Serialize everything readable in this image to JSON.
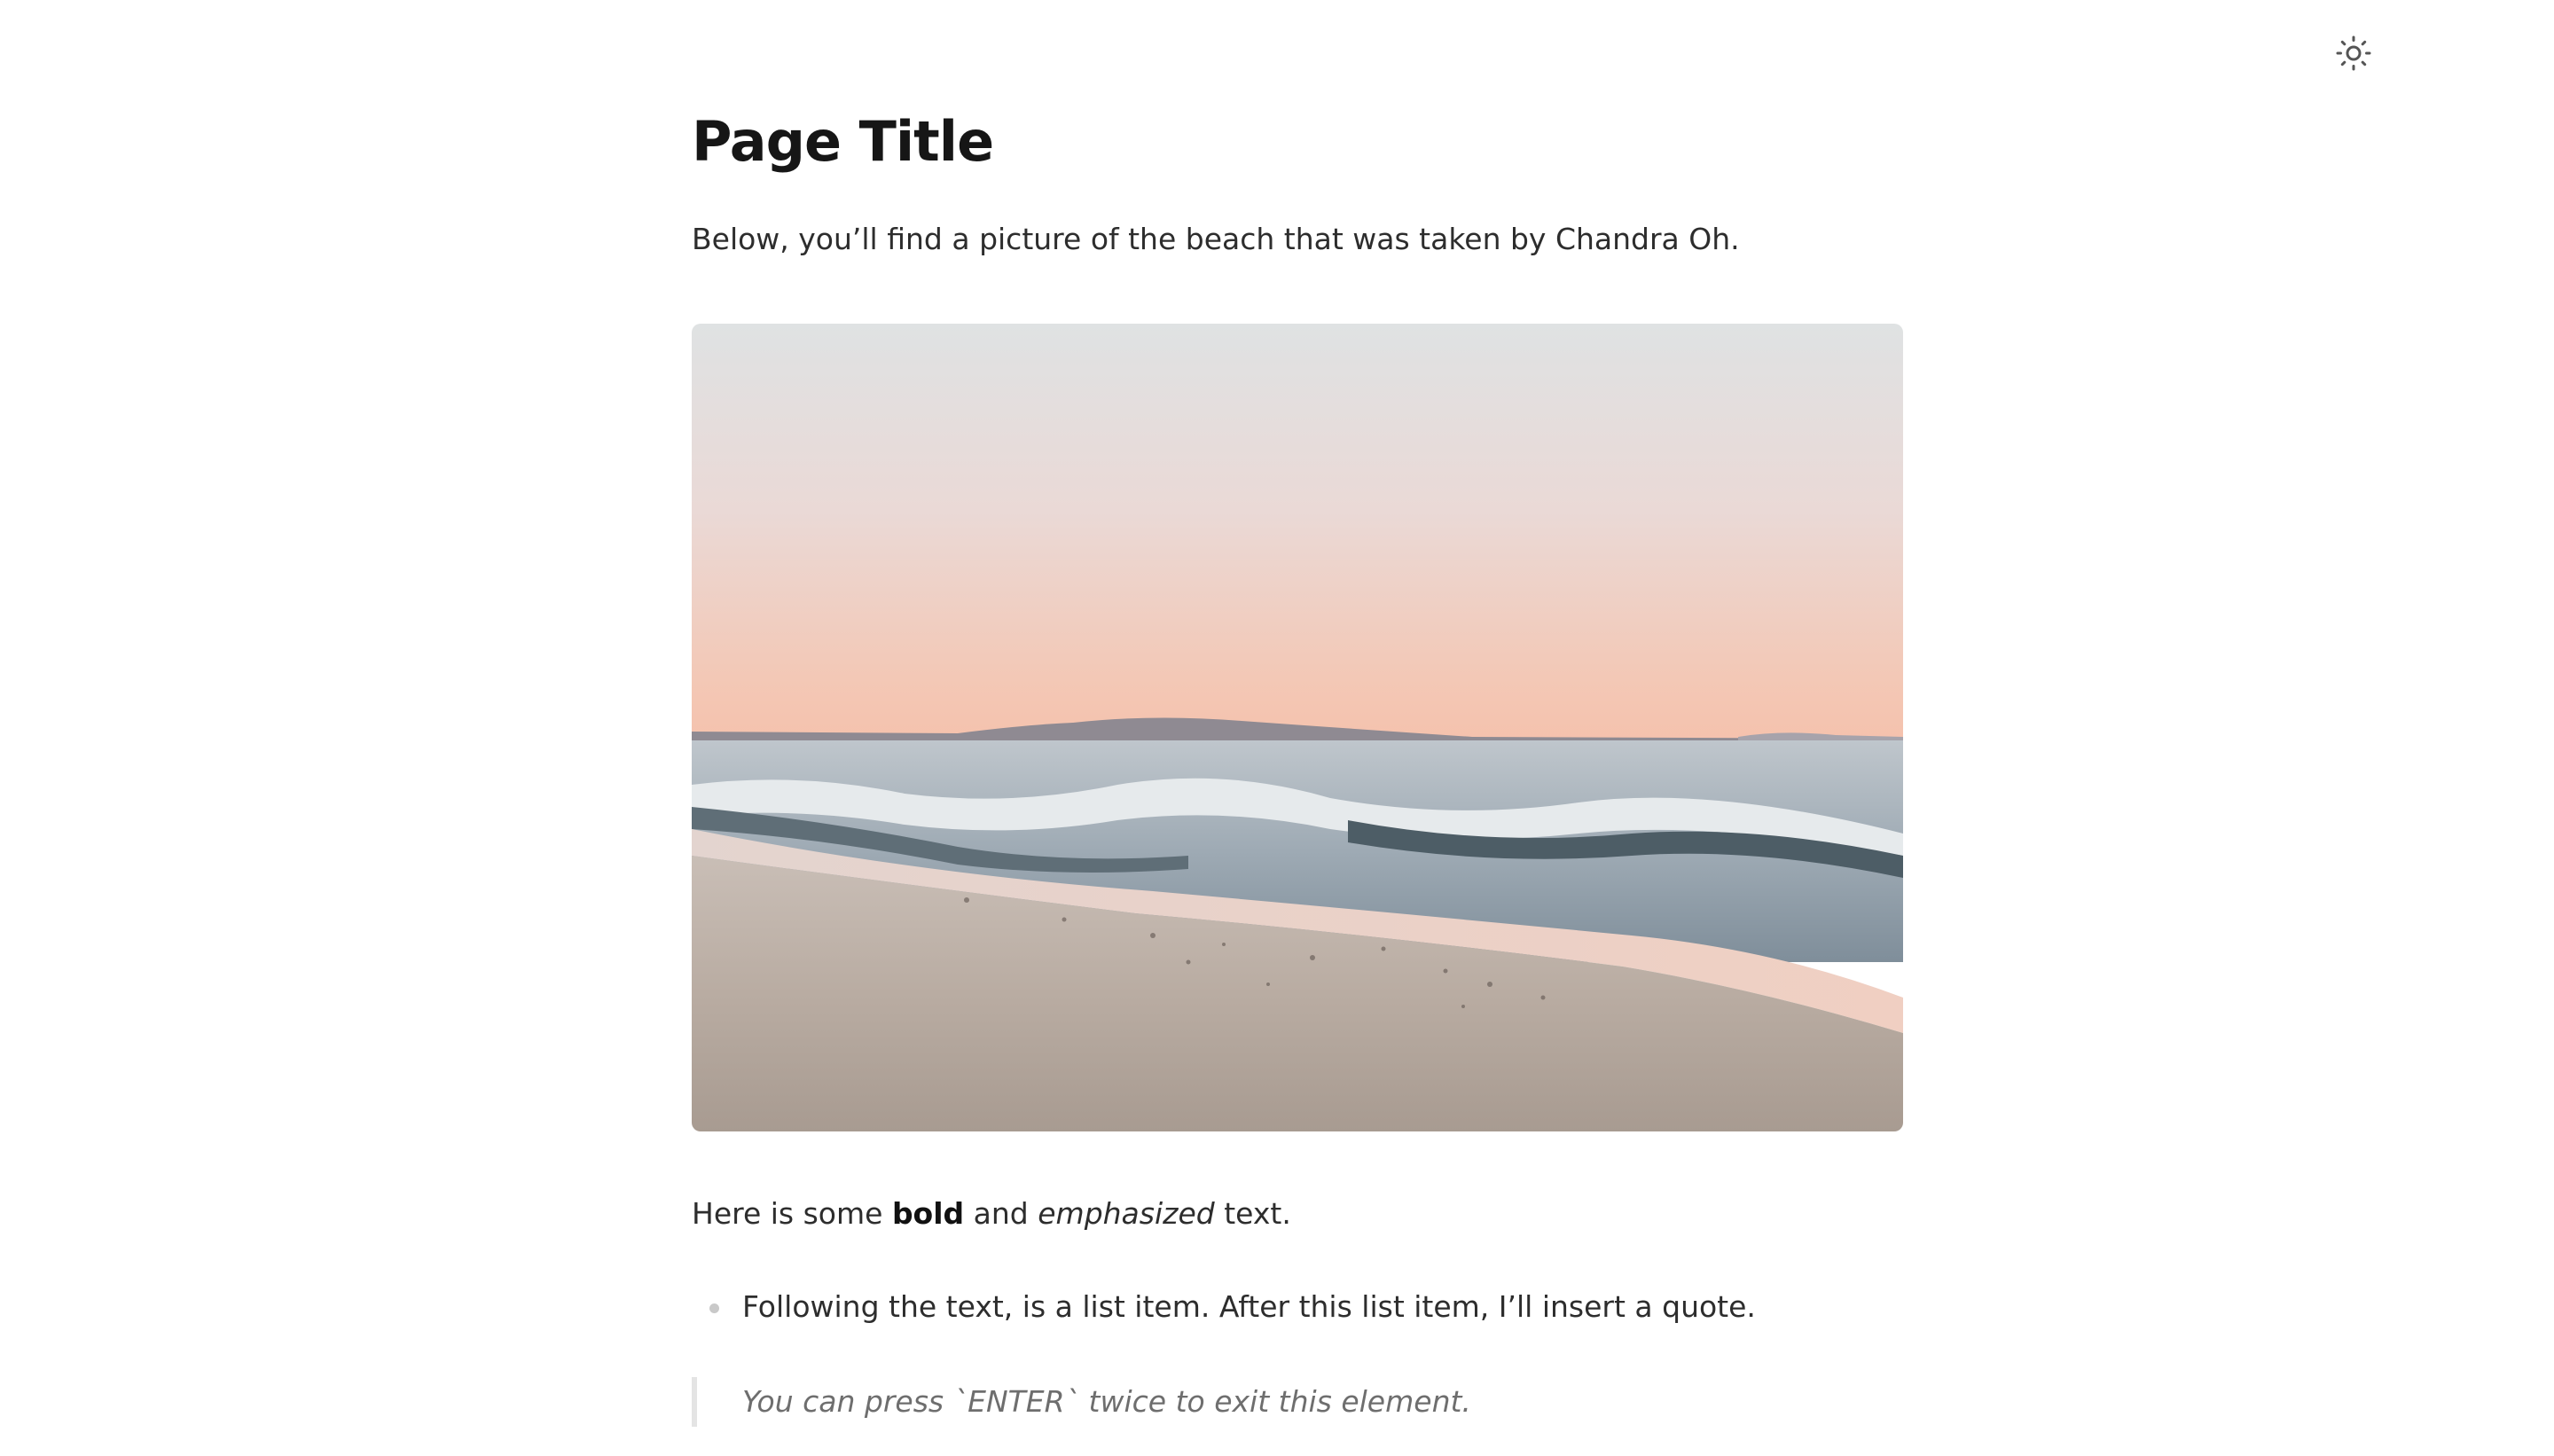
{
  "header": {
    "theme_toggle_icon": "sun-icon"
  },
  "document": {
    "title": "Page Title",
    "intro": "Below, you’ll find a picture of the beach that was taken by Chandra Oh.",
    "image": {
      "subject": "beach-photo"
    },
    "rich_line": {
      "prefix": "Here is some ",
      "bold": "bold",
      "middle": " and ",
      "emphasized": "emphasized",
      "suffix": " text."
    },
    "list_items": [
      "Following the text, is a list item. After this list item, I’ll insert a quote."
    ],
    "quote": "You can press `ENTER` twice to exit this element."
  },
  "colors": {
    "text": "#2d2d2d",
    "title": "#161616",
    "quote_text": "#6e6e6e",
    "quote_border": "#e4e4e4",
    "bullet": "#c9c9c9"
  }
}
